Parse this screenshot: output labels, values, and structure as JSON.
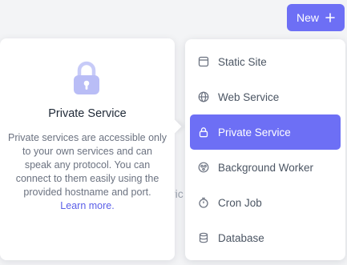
{
  "header": {
    "new_button_label": "New"
  },
  "backdrop": {
    "partial_text": "ric"
  },
  "info_card": {
    "title": "Private Service",
    "description": "Private services are accessible only to your own services and can speak any protocol. You can connect to them easily using the provided hostname and port.",
    "link_label": "Learn more.",
    "icon": "lock-icon"
  },
  "menu": {
    "items": [
      {
        "label": "Static Site",
        "icon": "static-site-icon"
      },
      {
        "label": "Web Service",
        "icon": "globe-icon"
      },
      {
        "label": "Private Service",
        "icon": "lock-icon",
        "selected": true
      },
      {
        "label": "Background Worker",
        "icon": "gears-icon"
      },
      {
        "label": "Cron Job",
        "icon": "stopwatch-icon"
      },
      {
        "label": "Database",
        "icon": "database-icon"
      }
    ]
  },
  "colors": {
    "accent": "#6d6ff5",
    "link": "#5b5fe8",
    "lock_illustration": "#b9bdf6"
  }
}
